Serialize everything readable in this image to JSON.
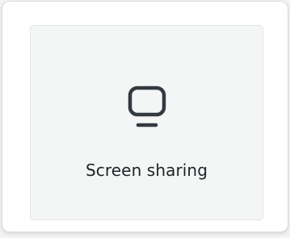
{
  "tile": {
    "icon": "monitor-icon",
    "label": "Screen sharing"
  },
  "colors": {
    "icon": "#323a40",
    "text": "#1f2326",
    "tile_background": "#f4f5f5",
    "card_background": "#ffffff"
  }
}
